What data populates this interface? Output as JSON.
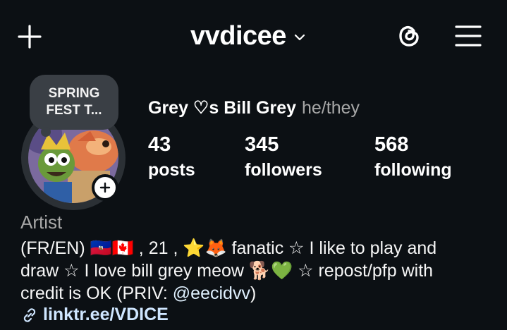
{
  "header": {
    "username": "vvdicee",
    "icons": [
      "plus-icon",
      "chevron-down-icon",
      "threads-icon",
      "menu-icon"
    ]
  },
  "note": {
    "text": "SPRING\nFEST T..."
  },
  "profile": {
    "display_name": "Grey ♡s Bill Grey",
    "pronouns": "he/they",
    "avatar_icon": "avatar",
    "add_story_icon": "add-story-icon"
  },
  "stats": [
    {
      "value": "43",
      "label": "posts"
    },
    {
      "value": "345",
      "label": "followers"
    },
    {
      "value": "568",
      "label": "following"
    }
  ],
  "bio": {
    "category": "Artist",
    "line1": "(FR/EN) 🇭🇹🇨🇦 , 21 , ⭐🦊 fanatic ☆ I like to play and",
    "line2": "draw ☆ I love bill grey meow 🐕💚 ☆ repost/pfp with",
    "line3_pre": "credit is OK (PRIV: ",
    "mention": "@eecidvv",
    "line3_post": ")",
    "link": "linktr.ee/VDICE"
  },
  "colors": {
    "background": "#0c1014",
    "text": "#f5f5f5",
    "secondary_text": "#a8a8a8",
    "link": "#e0f1ff",
    "note_bubble": "#3a3f45"
  }
}
